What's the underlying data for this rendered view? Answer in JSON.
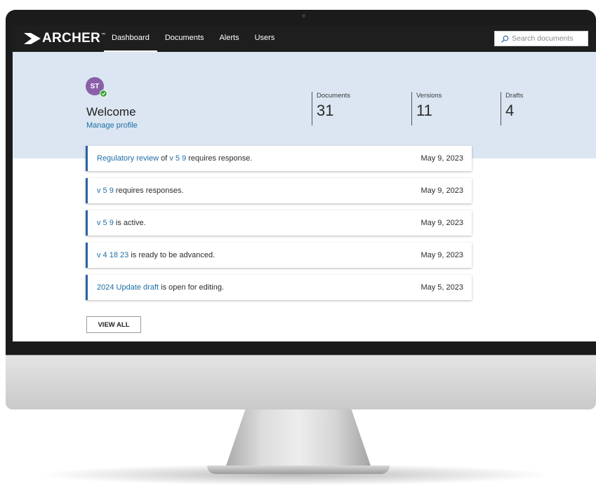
{
  "app": {
    "logo_text": "ARCHER",
    "logo_mark": "chevron-logo-icon",
    "trademark": "™"
  },
  "nav": {
    "items": [
      {
        "label": "Dashboard",
        "active": true
      },
      {
        "label": "Documents",
        "active": false
      },
      {
        "label": "Alerts",
        "active": false
      },
      {
        "label": "Users",
        "active": false
      }
    ]
  },
  "search": {
    "placeholder": "Search documents",
    "icon": "search-icon"
  },
  "profile": {
    "initials": "ST",
    "status_icon": "check-icon",
    "welcome": "Welcome",
    "manage_link": "Manage profile"
  },
  "stats": [
    {
      "label": "Documents",
      "value": "31"
    },
    {
      "label": "Versions",
      "value": "11"
    },
    {
      "label": "Drafts",
      "value": "4"
    }
  ],
  "alerts": [
    {
      "link1": "Regulatory review",
      "mid": " of ",
      "link2": "v 5 9",
      "text": " requires response.",
      "date": "May 9, 2023"
    },
    {
      "link1": "v 5 9",
      "mid": "",
      "link2": "",
      "text": " requires responses.",
      "date": "May 9, 2023"
    },
    {
      "link1": "v 5 9",
      "mid": "",
      "link2": "",
      "text": " is active.",
      "date": "May 9, 2023"
    },
    {
      "link1": "v 4 18 23",
      "mid": "",
      "link2": "",
      "text": " is ready to be advanced.",
      "date": "May 9, 2023"
    },
    {
      "link1": "2024 Update draft",
      "mid": "",
      "link2": "",
      "text": " is open for editing.",
      "date": "May 5, 2023"
    }
  ],
  "view_all_label": "VIEW ALL",
  "colors": {
    "topbar": "#1e1e1e",
    "hero": "#dbe6f2",
    "link": "#1d6fa5",
    "alert_accent": "#2a63a5",
    "avatar": "#8a5fa8",
    "status_ok": "#3aa53a"
  }
}
